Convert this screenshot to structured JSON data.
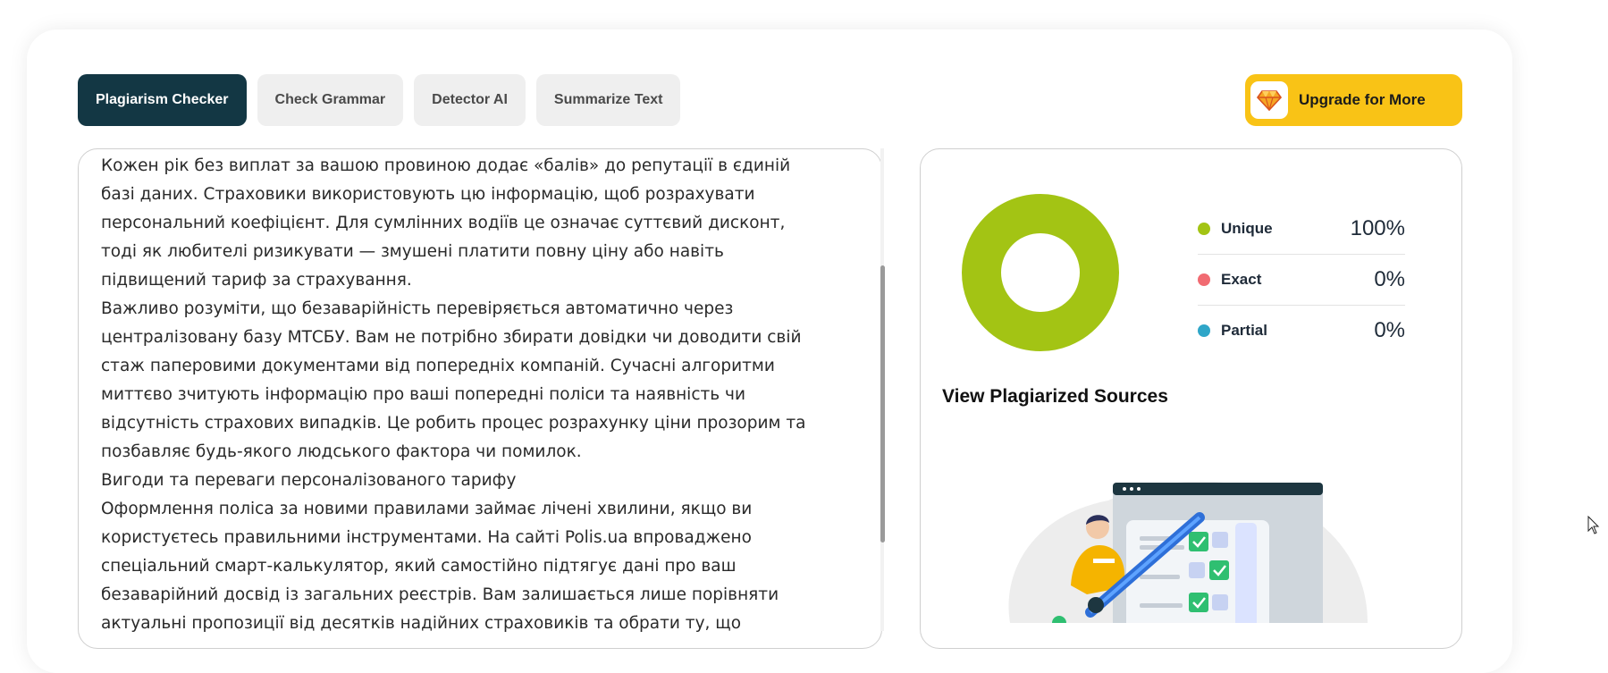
{
  "tabs": [
    {
      "label": "Plagiarism Checker",
      "active": true
    },
    {
      "label": "Check Grammar",
      "active": false
    },
    {
      "label": "Detector AI",
      "active": false
    },
    {
      "label": "Summarize Text",
      "active": false
    }
  ],
  "upgrade": {
    "label": "Upgrade for More",
    "icon": "diamond-icon"
  },
  "editor": {
    "lines": [
      "Кожен рік без виплат за вашою провиною додає «балів» до репутації в єдиній",
      "базі даних. Страховики використовують цю інформацію, щоб розрахувати",
      "персональний коефіцієнт. Для сумлінних водіїв це означає суттєвий дисконт,",
      "тоді як любителі ризикувати — змушені платити повну ціну або навіть",
      "підвищений тариф за страхування.",
      "Важливо розуміти, що безаварійність перевіряється автоматично через",
      "централізовану базу МТСБУ. Вам не потрібно збирати довідки чи доводити свій",
      "стаж паперовими документами від попередніх компаній. Сучасні алгоритми",
      "миттєво зчитують інформацію про ваші попередні поліси та наявність чи",
      "відсутність страхових випадків. Це робить процес розрахунку ціни прозорим та",
      "позбавляє будь-якого людського фактора чи помилок.",
      "Вигоди та переваги персоналізованого тарифу",
      "Оформлення поліса за новими правилами займає лічені хвилини, якщо ви",
      "користуєтесь правильними інструментами. На сайті Polis.ua впроваджено",
      "спеціальний смарт-калькулятор, який самостійно підтягує дані про ваш",
      "безаварійний досвід із загальних реєстрів. Вам залишається лише порівняти",
      "актуальні пропозиції від десятків надійних страховиків та обрати ту, що"
    ]
  },
  "results": {
    "stats": [
      {
        "name": "Unique",
        "value": "100%",
        "fraction": 1.0,
        "color": "#a3c414"
      },
      {
        "name": "Exact",
        "value": "0%",
        "fraction": 0.0,
        "color": "#f16b72"
      },
      {
        "name": "Partial",
        "value": "0%",
        "fraction": 0.0,
        "color": "#2fa6c8"
      }
    ],
    "view_sources_label": "View Plagiarized Sources"
  }
}
